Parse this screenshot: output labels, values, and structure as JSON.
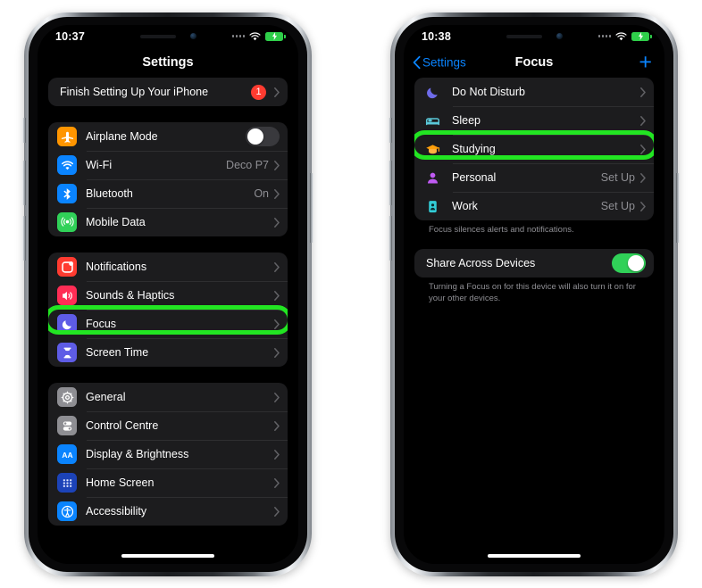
{
  "phones": [
    {
      "id": "settings-phone",
      "status_bar": {
        "time": "10:37",
        "signal_icon": "signal-dots-icon",
        "wifi_icon": "wifi-icon",
        "battery_icon": "battery-charging-icon"
      },
      "nav": {
        "title": "Settings"
      },
      "banner": {
        "label": "Finish Setting Up Your iPhone",
        "badge": "1",
        "chevron_icon": "chevron-right-icon"
      },
      "groups": [
        {
          "name": "connectivity-group",
          "rows": [
            {
              "label": "Airplane Mode",
              "icon": "airplane-icon",
              "icon_color": "#ff9500",
              "control": "toggle",
              "toggle_on": false
            },
            {
              "label": "Wi-Fi",
              "icon": "wifi-icon",
              "icon_color": "#0a84ff",
              "value": "Deco P7",
              "control": "chevron"
            },
            {
              "label": "Bluetooth",
              "icon": "bluetooth-icon",
              "icon_color": "#0a84ff",
              "value": "On",
              "control": "chevron"
            },
            {
              "label": "Mobile Data",
              "icon": "antenna-icon",
              "icon_color": "#30d158",
              "value": "",
              "control": "chevron"
            }
          ]
        },
        {
          "name": "notifications-group",
          "rows": [
            {
              "label": "Notifications",
              "icon": "notification-badge-icon",
              "icon_color": "#ff3b30",
              "value": "",
              "control": "chevron"
            },
            {
              "label": "Sounds & Haptics",
              "icon": "speaker-wave-icon",
              "icon_color": "#ff2d55",
              "value": "",
              "control": "chevron"
            },
            {
              "label": "Focus",
              "icon": "moon-icon",
              "icon_color": "#5e5ce6",
              "value": "",
              "control": "chevron",
              "highlighted": true
            },
            {
              "label": "Screen Time",
              "icon": "hourglass-icon",
              "icon_color": "#5e5ce6",
              "value": "",
              "control": "chevron"
            }
          ]
        },
        {
          "name": "general-group",
          "rows": [
            {
              "label": "General",
              "icon": "gear-icon",
              "icon_color": "#8e8e93",
              "value": "",
              "control": "chevron"
            },
            {
              "label": "Control Centre",
              "icon": "sliders-icon",
              "icon_color": "#8e8e93",
              "value": "",
              "control": "chevron"
            },
            {
              "label": "Display & Brightness",
              "icon": "aa-text-icon",
              "icon_color": "#0a84ff",
              "value": "",
              "control": "chevron"
            },
            {
              "label": "Home Screen",
              "icon": "home-grid-icon",
              "icon_color": "#1c43b8",
              "value": "",
              "control": "chevron"
            },
            {
              "label": "Accessibility",
              "icon": "accessibility-icon",
              "icon_color": "#0a84ff",
              "value": "",
              "control": "chevron"
            }
          ]
        }
      ]
    },
    {
      "id": "focus-phone",
      "status_bar": {
        "time": "10:38",
        "signal_icon": "signal-dots-icon",
        "wifi_icon": "wifi-icon",
        "battery_icon": "battery-charging-icon"
      },
      "nav": {
        "title": "Focus",
        "back_label": "Settings",
        "back_icon": "chevron-left-icon",
        "add_label": "+"
      },
      "focus_list": [
        {
          "label": "Do Not Disturb",
          "icon": "moon-icon",
          "icon_color": "#6e6bea",
          "value": "",
          "control": "chevron"
        },
        {
          "label": "Sleep",
          "icon": "bed-icon",
          "icon_color": "#5ac8d8",
          "value": "",
          "control": "chevron"
        },
        {
          "label": "Studying",
          "icon": "graduation-cap-icon",
          "icon_color": "#ff9f0a",
          "value": "",
          "control": "chevron",
          "highlighted": true
        },
        {
          "label": "Personal",
          "icon": "person-icon",
          "icon_color": "#bf5af2",
          "value": "Set Up",
          "control": "chevron"
        },
        {
          "label": "Work",
          "icon": "id-badge-icon",
          "icon_color": "#32ccd6",
          "value": "Set Up",
          "control": "chevron"
        }
      ],
      "focus_footnote": "Focus silences alerts and notifications.",
      "share_row": {
        "label": "Share Across Devices",
        "toggle_on": true
      },
      "share_footnote": "Turning a Focus on for this device will also turn it on for your other devices."
    }
  ],
  "colors": {
    "highlight_ring": "#22e522",
    "accent_blue": "#0a84ff",
    "badge_red": "#ff3b30",
    "toggle_green": "#30d158",
    "group_bg": "#1c1c1e"
  }
}
